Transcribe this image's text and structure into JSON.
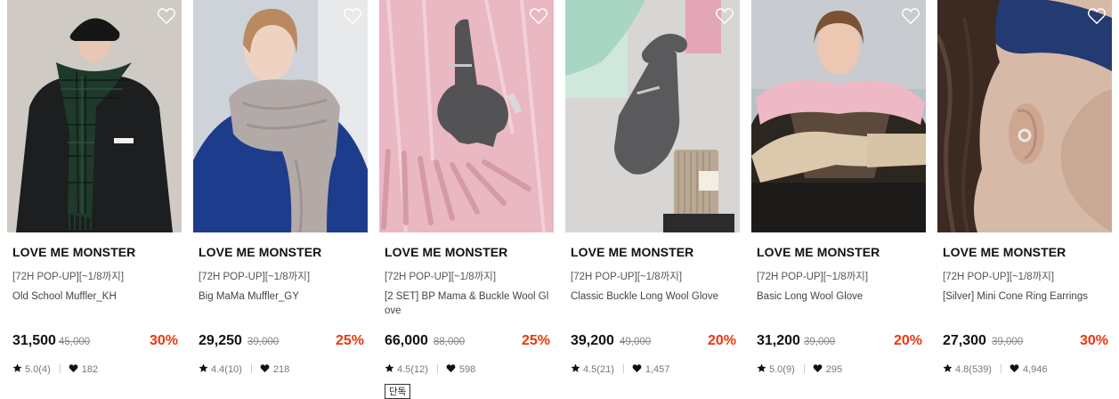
{
  "products": [
    {
      "brand": "LOVE ME MONSTER",
      "promo": "[72H POP-UP][~1/8까지]",
      "name": "Old School Muffler_KH",
      "price": "31,500",
      "original_price": "45,000",
      "discount": "30%",
      "rating": "5.0(4)",
      "likes": "182",
      "image_desc": "model wearing green tartan scarf and black beret"
    },
    {
      "brand": "LOVE ME MONSTER",
      "promo": "[72H POP-UP][~1/8까지]",
      "name": "Big MaMa Muffler_GY",
      "price": "29,250",
      "original_price": "39,000",
      "discount": "25%",
      "rating": "4.4(10)",
      "likes": "218",
      "image_desc": "model wearing grey oversized muffler"
    },
    {
      "brand": "LOVE ME MONSTER",
      "promo": "[72H POP-UP][~1/8까지]",
      "name": "[2 SET] BP Mama & Buckle Wool Glove",
      "price": "66,000",
      "original_price": "88,000",
      "discount": "25%",
      "rating": "4.5(12)",
      "likes": "598",
      "tag": "단독",
      "image_desc": "grey glove on pink fringed muffler"
    },
    {
      "brand": "LOVE ME MONSTER",
      "promo": "[72H POP-UP][~1/8까지]",
      "name": "Classic Buckle Long Wool Glove",
      "price": "39,200",
      "original_price": "49,000",
      "discount": "20%",
      "rating": "4.5(21)",
      "likes": "1,457",
      "image_desc": "hand in grey long wool glove with beige sock"
    },
    {
      "brand": "LOVE ME MONSTER",
      "promo": "[72H POP-UP][~1/8까지]",
      "name": "Basic Long Wool Glove",
      "price": "31,200",
      "original_price": "39,000",
      "discount": "20%",
      "rating": "5.0(9)",
      "likes": "295",
      "image_desc": "model in pink muffler and beige long gloves"
    },
    {
      "brand": "LOVE ME MONSTER",
      "promo": "[72H POP-UP][~1/8까지]",
      "name": "[Silver] Mini Cone Ring Earrings",
      "price": "27,300",
      "original_price": "39,000",
      "discount": "30%",
      "rating": "4.8(539)",
      "likes": "4,946",
      "image_desc": "close-up of ear with silver ring earring and blue beanie"
    }
  ],
  "colors": {
    "discount": "#f0340d",
    "text": "#111111",
    "muted": "#888888"
  },
  "icons": {
    "wishlist": "heart-outline-icon",
    "rating": "star-icon",
    "likes": "heart-filled-icon"
  }
}
